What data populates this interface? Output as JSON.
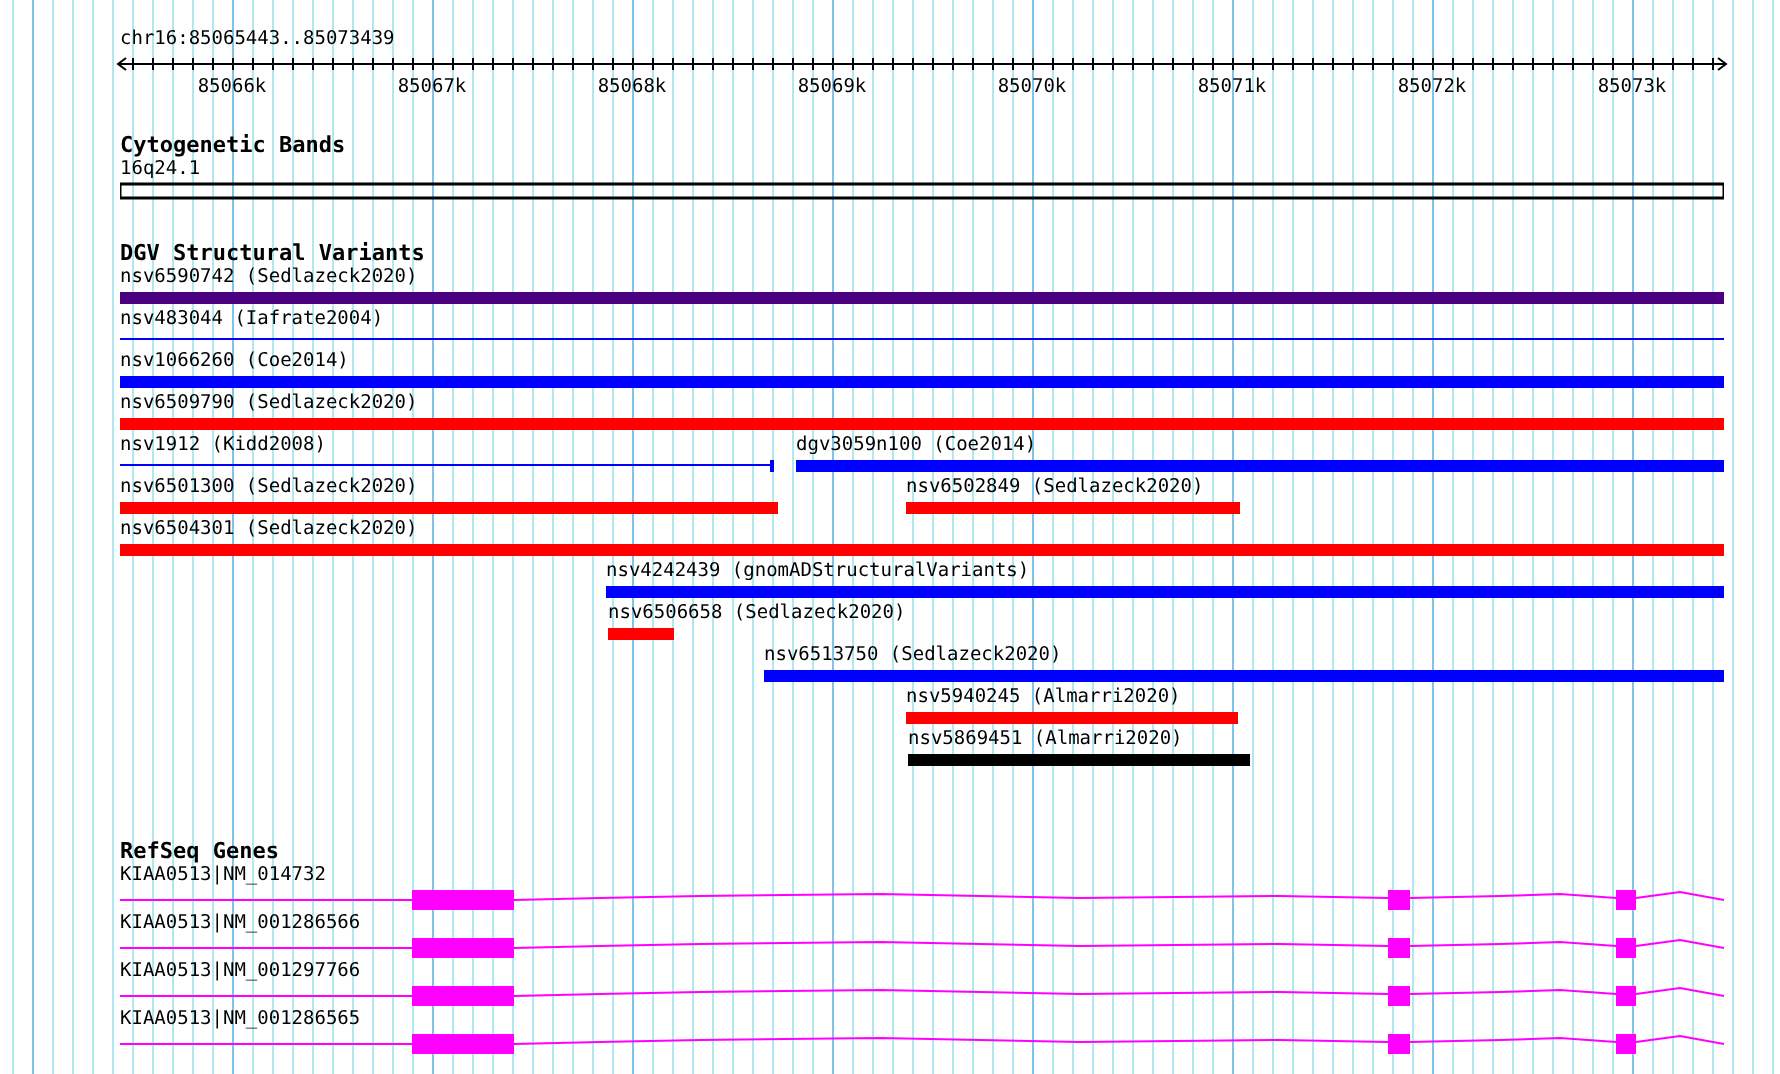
{
  "ruler": {
    "location": "chr16:85065443..85073439",
    "ticks": [
      "85066k",
      "85067k",
      "85068k",
      "85069k",
      "85070k",
      "85071k",
      "85072k",
      "85073k"
    ]
  },
  "cytogenetic_bands": {
    "title": "Cytogenetic Bands",
    "band": "16q24.1"
  },
  "dgv_variants": {
    "title": "DGV Structural Variants",
    "rows": [
      {
        "features": [
          {
            "label": "nsv6590742 (Sedlazeck2020)",
            "color": "#4b0082",
            "kind": "thick"
          }
        ]
      },
      {
        "features": [
          {
            "label": "nsv483044 (Iafrate2004)",
            "color": "#0000ff",
            "kind": "thin"
          }
        ]
      },
      {
        "features": [
          {
            "label": "nsv1066260 (Coe2014)",
            "color": "#0000ff",
            "kind": "thick"
          }
        ]
      },
      {
        "features": [
          {
            "label": "nsv6509790 (Sedlazeck2020)",
            "color": "#ff0000",
            "kind": "thick"
          }
        ]
      },
      {
        "features": [
          {
            "label": "nsv1912 (Kidd2008)",
            "color": "#0000ff",
            "kind": "thin"
          },
          {
            "label": "dgv3059n100 (Coe2014)",
            "color": "#0000ff",
            "kind": "thick"
          }
        ]
      },
      {
        "features": [
          {
            "label": "nsv6501300 (Sedlazeck2020)",
            "color": "#ff0000",
            "kind": "thick"
          },
          {
            "label": "nsv6502849 (Sedlazeck2020)",
            "color": "#ff0000",
            "kind": "thick"
          }
        ]
      },
      {
        "features": [
          {
            "label": "nsv6504301 (Sedlazeck2020)",
            "color": "#ff0000",
            "kind": "thick"
          }
        ]
      },
      {
        "features": [
          {
            "label": "nsv4242439 (gnomADStructuralVariants)",
            "color": "#0000ff",
            "kind": "thick"
          }
        ]
      },
      {
        "features": [
          {
            "label": "nsv6506658 (Sedlazeck2020)",
            "color": "#ff0000",
            "kind": "thick"
          }
        ]
      },
      {
        "features": [
          {
            "label": "nsv6513750 (Sedlazeck2020)",
            "color": "#0000ff",
            "kind": "thick"
          }
        ]
      },
      {
        "features": [
          {
            "label": "nsv5940245 (Almarri2020)",
            "color": "#ff0000",
            "kind": "thick"
          }
        ]
      },
      {
        "features": [
          {
            "label": "nsv5869451 (Almarri2020)",
            "color": "#000000",
            "kind": "thick"
          }
        ]
      }
    ]
  },
  "refseq_genes": {
    "title": "RefSeq Genes",
    "genes": [
      {
        "label": "KIAA0513|NM_014732"
      },
      {
        "label": "KIAA0513|NM_001286566"
      },
      {
        "label": "KIAA0513|NM_001297766"
      },
      {
        "label": "KIAA0513|NM_001286565"
      }
    ]
  }
}
